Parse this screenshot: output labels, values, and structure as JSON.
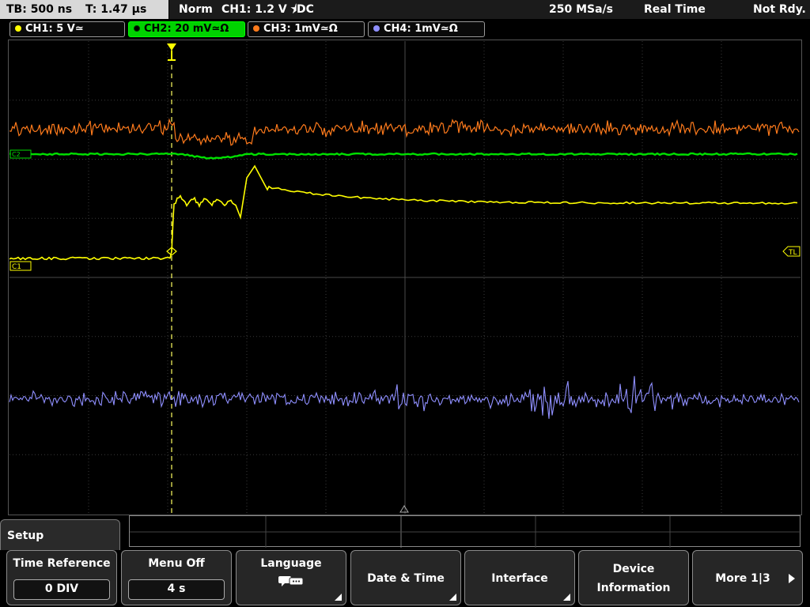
{
  "status": {
    "timebase": "TB: 500 ns",
    "trigger_time": "T: 1.47 µs",
    "mode": "Norm",
    "trigger_info": "CH1: 1.2 V ⯨DC",
    "sample_rate": "250 MSa/s",
    "acq_mode": "Real Time",
    "state": "Not Rdy."
  },
  "channels": [
    {
      "label": "CH1: 5 V≃",
      "color": "#ffff00"
    },
    {
      "label": "CH2: 20 mV≃Ω",
      "color": "#00e000"
    },
    {
      "label": "CH3: 1mV≃Ω",
      "color": "#ff7b1c"
    },
    {
      "label": "CH4: 1mV≃Ω",
      "color": "#8f8fff"
    }
  ],
  "markers": {
    "ch1": "C1",
    "ch2": "C2",
    "trigger_level": "TL"
  },
  "menu": {
    "title": "Setup",
    "softkeys": [
      {
        "label": "Time Reference",
        "value": "0 DIV"
      },
      {
        "label": "Menu Off",
        "value": "4 s"
      },
      {
        "label": "Language",
        "icon": "speech-bubbles-icon"
      },
      {
        "label": "Date & Time"
      },
      {
        "label": "Interface"
      },
      {
        "label_line1": "Device",
        "label_line2": "Information"
      },
      {
        "label": "More 1|3"
      }
    ]
  }
}
